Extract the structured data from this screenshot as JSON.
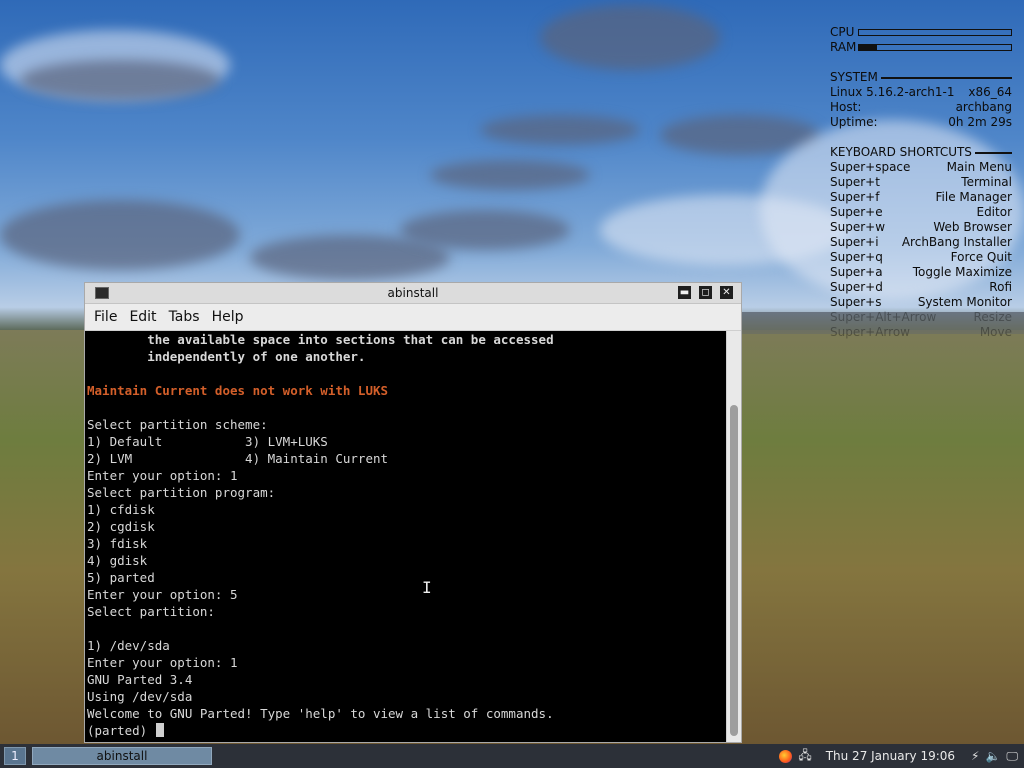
{
  "conky": {
    "cpu_label": "CPU",
    "ram_label": "RAM",
    "cpu_fraction": 0.0,
    "ram_fraction": 0.12,
    "system_heading": "SYSTEM",
    "system_rows": [
      {
        "label": "Linux 5.16.2-arch1-1",
        "value": "x86_64"
      },
      {
        "label": "Host:",
        "value": "archbang"
      },
      {
        "label": "Uptime:",
        "value": "0h 2m 29s"
      }
    ],
    "shortcuts_heading": "KEYBOARD SHORTCUTS",
    "shortcuts": [
      {
        "key": "Super+space",
        "action": "Main Menu"
      },
      {
        "key": "Super+t",
        "action": "Terminal"
      },
      {
        "key": "Super+f",
        "action": "File Manager"
      },
      {
        "key": "Super+e",
        "action": "Editor"
      },
      {
        "key": "Super+w",
        "action": "Web Browser"
      },
      {
        "key": "Super+i",
        "action": "ArchBang Installer"
      },
      {
        "key": "Super+q",
        "action": "Force Quit"
      },
      {
        "key": "Super+a",
        "action": "Toggle Maximize"
      },
      {
        "key": "Super+d",
        "action": "Rofi"
      },
      {
        "key": "Super+s",
        "action": "System Monitor"
      },
      {
        "key": "Super+Alt+Arrow",
        "action": "Resize"
      },
      {
        "key": "Super+Arrow",
        "action": "Move"
      }
    ]
  },
  "window": {
    "title": "abinstall",
    "controls": {
      "minimize": "▬",
      "maximize": "◻",
      "close": "✕"
    },
    "menu": [
      "File",
      "Edit",
      "Tabs",
      "Help"
    ],
    "terminal_lines": [
      {
        "text": "        the available space into sections that can be accessed",
        "style": "bold"
      },
      {
        "text": "        independently of one another.",
        "style": "bold"
      },
      {
        "text": "",
        "style": ""
      },
      {
        "text": "Maintain Current does not work with LUKS",
        "style": "warn"
      },
      {
        "text": "",
        "style": ""
      },
      {
        "text": "Select partition scheme:",
        "style": ""
      },
      {
        "text": "1) Default           3) LVM+LUKS",
        "style": ""
      },
      {
        "text": "2) LVM               4) Maintain Current",
        "style": ""
      },
      {
        "text": "Enter your option: 1",
        "style": ""
      },
      {
        "text": "Select partition program:",
        "style": ""
      },
      {
        "text": "1) cfdisk",
        "style": ""
      },
      {
        "text": "2) cgdisk",
        "style": ""
      },
      {
        "text": "3) fdisk",
        "style": ""
      },
      {
        "text": "4) gdisk",
        "style": ""
      },
      {
        "text": "5) parted",
        "style": ""
      },
      {
        "text": "Enter your option: 5",
        "style": ""
      },
      {
        "text": "Select partition:",
        "style": ""
      },
      {
        "text": "",
        "style": ""
      },
      {
        "text": "1) /dev/sda",
        "style": ""
      },
      {
        "text": "Enter your option: 1",
        "style": ""
      },
      {
        "text": "GNU Parted 3.4",
        "style": ""
      },
      {
        "text": "Using /dev/sda",
        "style": ""
      },
      {
        "text": "Welcome to GNU Parted! Type 'help' to view a list of commands.",
        "style": ""
      }
    ],
    "prompt": "(parted) "
  },
  "taskbar": {
    "workspace": "1",
    "task": "abinstall",
    "clock": "Thu 27 January  19:06"
  },
  "colors": {
    "warning_text": "#d35f2a",
    "taskbar_bg": "#2c3038"
  }
}
